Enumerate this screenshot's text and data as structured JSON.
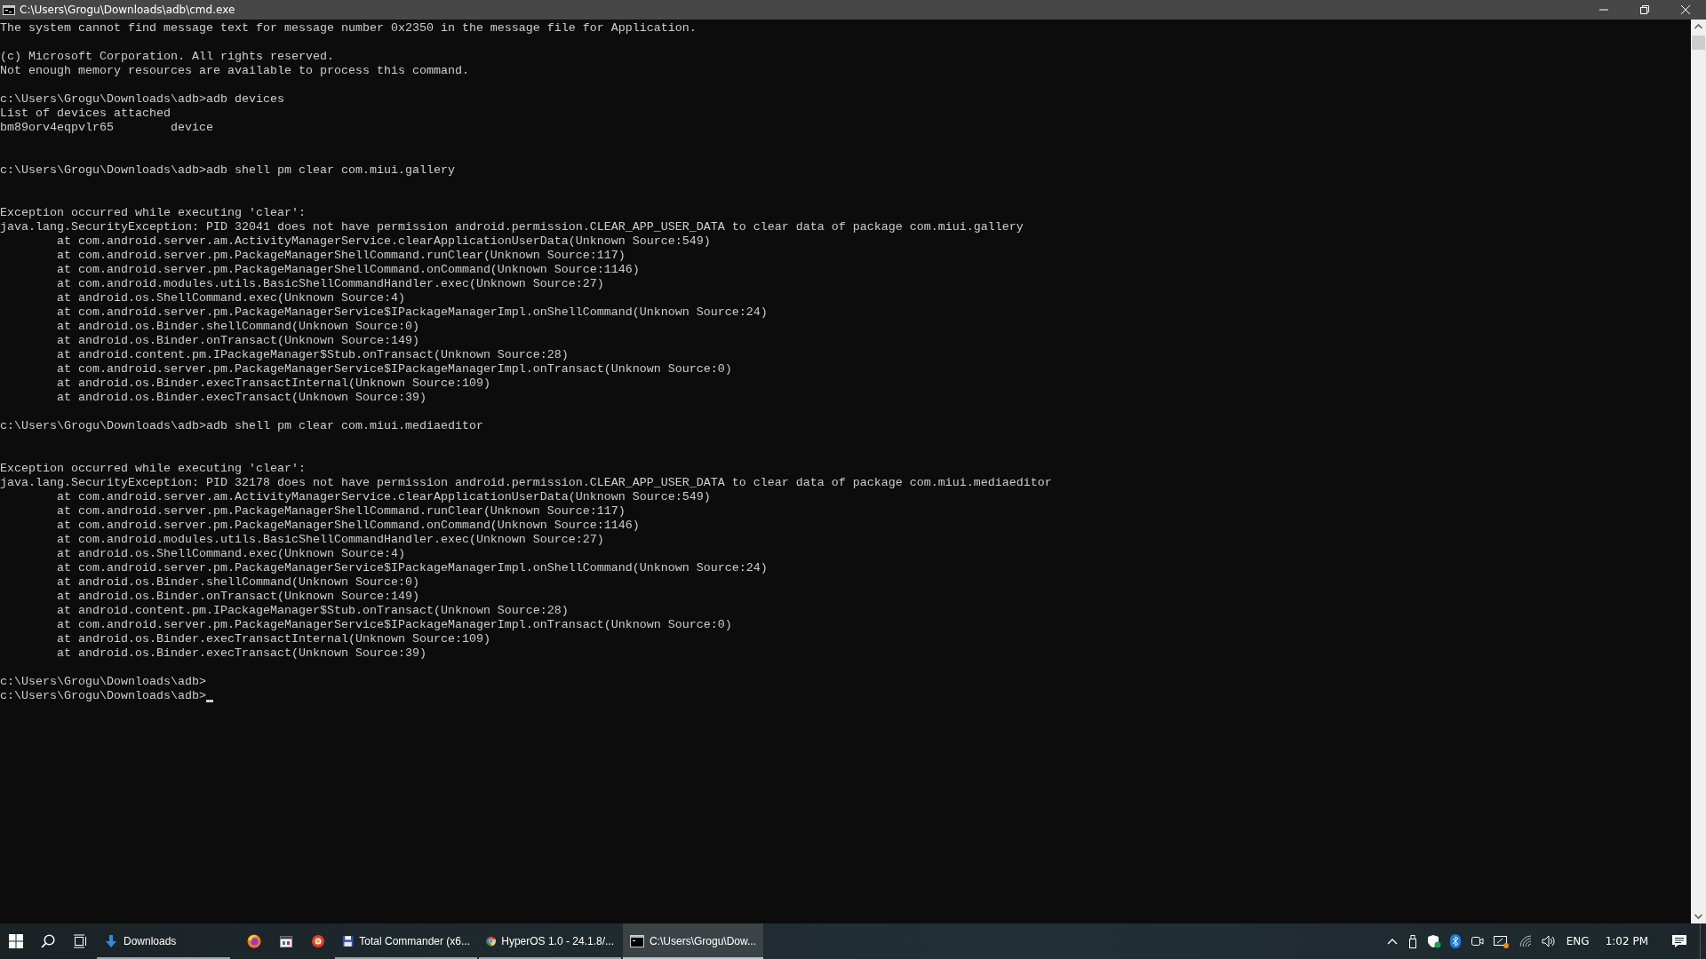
{
  "window": {
    "title": "C:\\Users\\Grogu\\Downloads\\adb\\cmd.exe"
  },
  "console": {
    "lines": [
      {
        "kind": "text",
        "text": "The system cannot find message text for message number 0x2350 in the message file for Application."
      },
      {
        "kind": "blank"
      },
      {
        "kind": "text",
        "text": "(c) Microsoft Corporation. All rights reserved."
      },
      {
        "kind": "text",
        "text": "Not enough memory resources are available to process this command."
      },
      {
        "kind": "blank"
      },
      {
        "kind": "text",
        "text": "c:\\Users\\Grogu\\Downloads\\adb>adb devices"
      },
      {
        "kind": "text",
        "text": "List of devices attached"
      },
      {
        "kind": "text",
        "text": "bm89orv4eqpvlr65        device"
      },
      {
        "kind": "blank"
      },
      {
        "kind": "blank"
      },
      {
        "kind": "text",
        "text": "c:\\Users\\Grogu\\Downloads\\adb>adb shell pm clear com.miui.gallery"
      },
      {
        "kind": "blank"
      },
      {
        "kind": "blank"
      },
      {
        "kind": "text",
        "text": "Exception occurred while executing 'clear':"
      },
      {
        "kind": "text",
        "text": "java.lang.SecurityException: PID 32041 does not have permission android.permission.CLEAR_APP_USER_DATA to clear data of package com.miui.gallery"
      },
      {
        "kind": "text",
        "text": "        at com.android.server.am.ActivityManagerService.clearApplicationUserData(Unknown Source:549)"
      },
      {
        "kind": "text",
        "text": "        at com.android.server.pm.PackageManagerShellCommand.runClear(Unknown Source:117)"
      },
      {
        "kind": "text",
        "text": "        at com.android.server.pm.PackageManagerShellCommand.onCommand(Unknown Source:1146)"
      },
      {
        "kind": "text",
        "text": "        at com.android.modules.utils.BasicShellCommandHandler.exec(Unknown Source:27)"
      },
      {
        "kind": "text",
        "text": "        at android.os.ShellCommand.exec(Unknown Source:4)"
      },
      {
        "kind": "text",
        "text": "        at com.android.server.pm.PackageManagerService$IPackageManagerImpl.onShellCommand(Unknown Source:24)"
      },
      {
        "kind": "text",
        "text": "        at android.os.Binder.shellCommand(Unknown Source:0)"
      },
      {
        "kind": "text",
        "text": "        at android.os.Binder.onTransact(Unknown Source:149)"
      },
      {
        "kind": "text",
        "text": "        at android.content.pm.IPackageManager$Stub.onTransact(Unknown Source:28)"
      },
      {
        "kind": "text",
        "text": "        at com.android.server.pm.PackageManagerService$IPackageManagerImpl.onTransact(Unknown Source:0)"
      },
      {
        "kind": "text",
        "text": "        at android.os.Binder.execTransactInternal(Unknown Source:109)"
      },
      {
        "kind": "text",
        "text": "        at android.os.Binder.execTransact(Unknown Source:39)"
      },
      {
        "kind": "blank"
      },
      {
        "kind": "text",
        "text": "c:\\Users\\Grogu\\Downloads\\adb>adb shell pm clear com.miui.mediaeditor"
      },
      {
        "kind": "blank"
      },
      {
        "kind": "blank"
      },
      {
        "kind": "text",
        "text": "Exception occurred while executing 'clear':"
      },
      {
        "kind": "text",
        "text": "java.lang.SecurityException: PID 32178 does not have permission android.permission.CLEAR_APP_USER_DATA to clear data of package com.miui.mediaeditor"
      },
      {
        "kind": "text",
        "text": "        at com.android.server.am.ActivityManagerService.clearApplicationUserData(Unknown Source:549)"
      },
      {
        "kind": "text",
        "text": "        at com.android.server.pm.PackageManagerShellCommand.runClear(Unknown Source:117)"
      },
      {
        "kind": "text",
        "text": "        at com.android.server.pm.PackageManagerShellCommand.onCommand(Unknown Source:1146)"
      },
      {
        "kind": "text",
        "text": "        at com.android.modules.utils.BasicShellCommandHandler.exec(Unknown Source:27)"
      },
      {
        "kind": "text",
        "text": "        at android.os.ShellCommand.exec(Unknown Source:4)"
      },
      {
        "kind": "text",
        "text": "        at com.android.server.pm.PackageManagerService$IPackageManagerImpl.onShellCommand(Unknown Source:24)"
      },
      {
        "kind": "text",
        "text": "        at android.os.Binder.shellCommand(Unknown Source:0)"
      },
      {
        "kind": "text",
        "text": "        at android.os.Binder.onTransact(Unknown Source:149)"
      },
      {
        "kind": "text",
        "text": "        at android.content.pm.IPackageManager$Stub.onTransact(Unknown Source:28)"
      },
      {
        "kind": "text",
        "text": "        at com.android.server.pm.PackageManagerService$IPackageManagerImpl.onTransact(Unknown Source:0)"
      },
      {
        "kind": "text",
        "text": "        at android.os.Binder.execTransactInternal(Unknown Source:109)"
      },
      {
        "kind": "text",
        "text": "        at android.os.Binder.execTransact(Unknown Source:39)"
      },
      {
        "kind": "blank"
      },
      {
        "kind": "text",
        "text": "c:\\Users\\Grogu\\Downloads\\adb>"
      },
      {
        "kind": "text",
        "text": "c:\\Users\\Grogu\\Downloads\\adb>"
      }
    ]
  },
  "taskbar": {
    "apps": [
      {
        "label": "Downloads",
        "running": true,
        "selected": false
      },
      {
        "running": false,
        "selected": false
      },
      {
        "running": false,
        "selected": false
      },
      {
        "running": false,
        "selected": false
      },
      {
        "label": "Total Commander (x6...",
        "running": true,
        "selected": false
      },
      {
        "label": "HyperOS 1.0 - 24.1.8/...",
        "running": true,
        "selected": false
      },
      {
        "label": "C:\\Users\\Grogu\\Dow...",
        "running": true,
        "selected": true
      }
    ],
    "language": "ENG",
    "time": "1:02 PM"
  }
}
